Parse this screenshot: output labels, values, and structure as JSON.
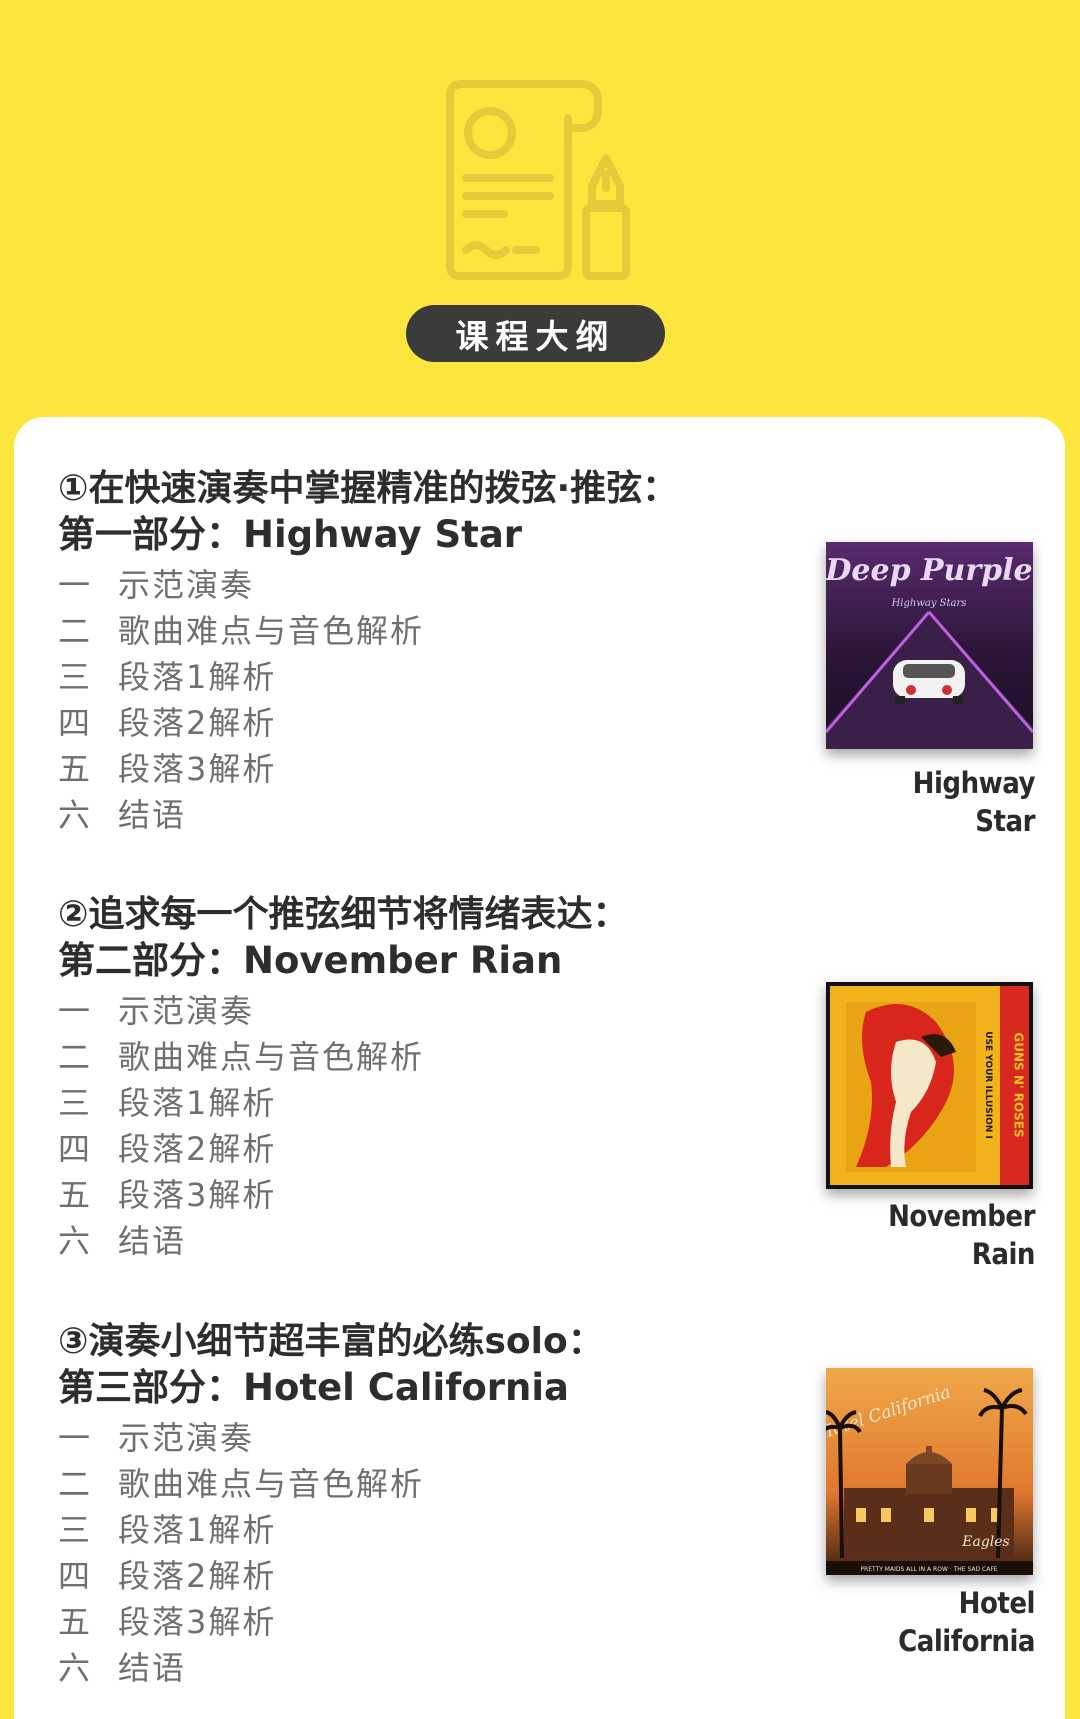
{
  "header": {
    "badge_title": "课程大纲",
    "icon": "document-pen-icon"
  },
  "sections": [
    {
      "heading": "①在快速演奏中掌握精准的拨弦·推弦：",
      "part": "第一部分：Highway Star",
      "items": [
        {
          "num": "一",
          "text": "示范演奏"
        },
        {
          "num": "二",
          "text": "歌曲难点与音色解析"
        },
        {
          "num": "三",
          "text": "段落1解析"
        },
        {
          "num": "四",
          "text": "段落2解析"
        },
        {
          "num": "五",
          "text": "段落3解析"
        },
        {
          "num": "六",
          "text": "结语"
        }
      ],
      "album": {
        "caption_line1": "Highway",
        "caption_line2": "Star",
        "cover_title": "Deep Purple",
        "cover_subtitle": "Highway Stars"
      }
    },
    {
      "heading": "②追求每一个推弦细节将情绪表达：",
      "part": "第二部分：November Rian",
      "items": [
        {
          "num": "一",
          "text": "示范演奏"
        },
        {
          "num": "二",
          "text": "歌曲难点与音色解析"
        },
        {
          "num": "三",
          "text": "段落1解析"
        },
        {
          "num": "四",
          "text": "段落2解析"
        },
        {
          "num": "五",
          "text": "段落3解析"
        },
        {
          "num": "六",
          "text": "结语"
        }
      ],
      "album": {
        "caption_line1": "November",
        "caption_line2": "Rain",
        "cover_title": "GUNS N' ROSES",
        "cover_subtitle": "USE YOUR ILLUSION I"
      }
    },
    {
      "heading": "③演奏小细节超丰富的必练solo：",
      "part": "第三部分：Hotel California",
      "items": [
        {
          "num": "一",
          "text": "示范演奏"
        },
        {
          "num": "二",
          "text": "歌曲难点与音色解析"
        },
        {
          "num": "三",
          "text": "段落1解析"
        },
        {
          "num": "四",
          "text": "段落2解析"
        },
        {
          "num": "五",
          "text": "段落3解析"
        },
        {
          "num": "六",
          "text": "结语"
        }
      ],
      "album": {
        "caption_line1": "Hotel",
        "caption_line2": "California",
        "cover_title": "Hotel California",
        "cover_subtitle": "Eagles",
        "cover_footer": "PRETTY MAIDS ALL IN A ROW · THE SAD CAFE"
      }
    }
  ],
  "colors": {
    "background": "#FCE63E",
    "badge": "#3B3B3B",
    "card": "#FFFFFF",
    "heading": "#2D2D2D",
    "item_text": "#6F6F6F",
    "icon_stroke": "#E8C93A"
  }
}
